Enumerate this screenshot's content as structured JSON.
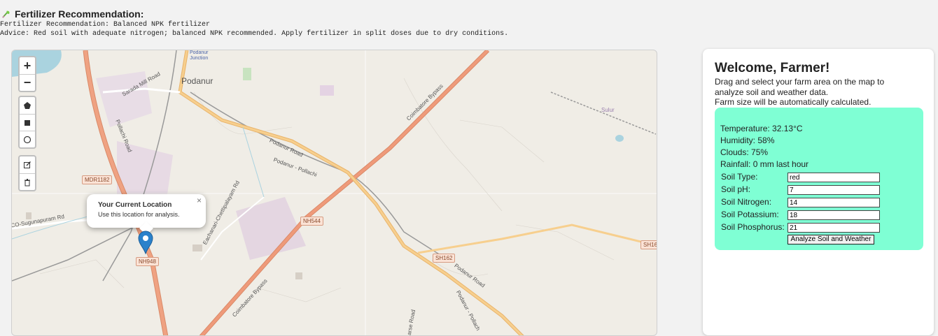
{
  "result": {
    "header": "Fertilizer Recommendation:",
    "recommendation_line": "Fertilizer Recommendation: Balanced NPK fertilizer",
    "advice_line": "Advice: Red soil with adequate nitrogen; balanced NPK recommended. Apply fertilizer in split doses due to dry conditions."
  },
  "map": {
    "zoom_in": "+",
    "zoom_out": "−",
    "draw_tools": [
      "polygon-tool",
      "rectangle-tool",
      "circle-tool"
    ],
    "edit_tools": [
      "edit-layers-tool",
      "delete-layers-tool"
    ],
    "popup": {
      "title": "Your Current Location",
      "text": "Use this location for analysis.",
      "close": "×"
    },
    "labels": {
      "podanur": "Podanur",
      "podanur_junction": "Podanur\nJunction",
      "sarada_mill_road": "Sarada Mill Road",
      "pollachi_road": "Pollachi Road",
      "coimbatore_bypass_top": "Coimbatore Bypass",
      "coimbatore_bypass_bottom": "Coimbatore Bypass",
      "podanur_road": "Podanur Road",
      "podanur_pollachi": "Podanur - Pollachi",
      "podanur_pollachi_2": "Podanur - Pollach",
      "podanur_road_2": "Podanur Road",
      "sulur": "Sulur",
      "sugunapuram": "CO-Sugunapuram Rd",
      "eachanari": "Eachanari-Chettipalayam Rd",
      "arse_road": "arse Road"
    },
    "shields": {
      "mdr1182": "MDR1182",
      "nh544": "NH544",
      "nh948": "NH948",
      "sh162": "SH162",
      "sh16": "SH16"
    }
  },
  "panel": {
    "title": "Welcome, Farmer!",
    "instructions": [
      "Drag and select your farm area on the map to",
      "analyze soil and weather data.",
      "Farm size will be automatically calculated."
    ],
    "weather": {
      "temperature": "Temperature: 32.13°C",
      "humidity": "Humidity: 58%",
      "clouds": "Clouds: 75%",
      "rainfall": "Rainfall: 0 mm last hour"
    },
    "soil": {
      "type_label": "Soil Type:",
      "type_value": "red",
      "ph_label": "Soil pH:",
      "ph_value": "7",
      "nitrogen_label": "Soil Nitrogen:",
      "nitrogen_value": "14",
      "potassium_label": "Soil Potassium:",
      "potassium_value": "18",
      "phosphorus_label": "Soil Phosphorus:",
      "phosphorus_value": "21"
    },
    "analyze_button": "Analyze Soil and Weather"
  },
  "colors": {
    "page_bg": "#f2f2f2",
    "analysis_bg": "#7fffd4",
    "major_road": "#e8926c",
    "secondary_road": "#f6c382",
    "marker": "#2a81cb"
  }
}
